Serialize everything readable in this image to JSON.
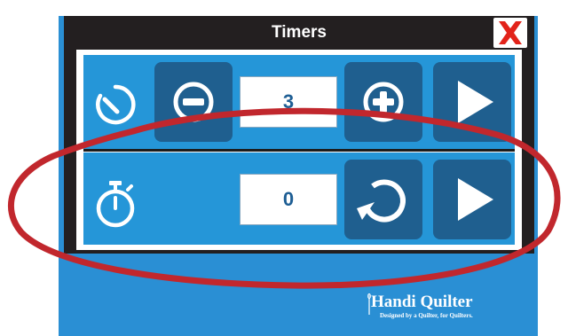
{
  "dialog": {
    "title": "Timers",
    "close_icon": "close-x-icon"
  },
  "timer_countdown": {
    "icon": "countdown-timer-icon",
    "decrement_icon": "minus-circle-icon",
    "value": "3",
    "increment_icon": "plus-circle-icon",
    "start_icon": "play-icon"
  },
  "timer_stopwatch": {
    "icon": "stopwatch-icon",
    "value": "0",
    "reset_icon": "reset-icon",
    "start_icon": "play-icon"
  },
  "branding": {
    "name": "Handi Quilter",
    "tagline": "Designed by a Quilter, for Quilters."
  },
  "colors": {
    "accent_blue": "#2596d8",
    "button_dark_blue": "#1f5f8f",
    "dialog_frame": "#231f20",
    "close_red": "#e2231a",
    "annotation_red": "#c1272d"
  }
}
